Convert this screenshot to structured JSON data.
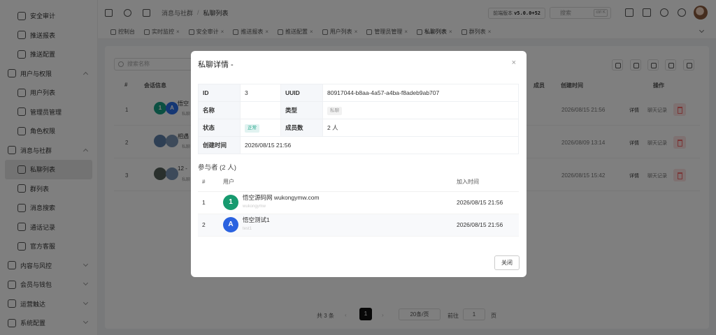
{
  "sidebar": {
    "items": [
      {
        "label": "安全审计",
        "level": 2
      },
      {
        "label": "推送报表",
        "level": 2
      },
      {
        "label": "推送配置",
        "level": 2
      },
      {
        "label": "用户与权限",
        "level": 1,
        "expanded": true
      },
      {
        "label": "用户列表",
        "level": 2
      },
      {
        "label": "管理员管理",
        "level": 2
      },
      {
        "label": "角色权限",
        "level": 2
      },
      {
        "label": "消息与社群",
        "level": 1,
        "expanded": true
      },
      {
        "label": "私聊列表",
        "level": 2,
        "active": true
      },
      {
        "label": "群列表",
        "level": 2
      },
      {
        "label": "消息搜索",
        "level": 2
      },
      {
        "label": "通话记录",
        "level": 2
      },
      {
        "label": "官方客服",
        "level": 2
      },
      {
        "label": "内容与风控",
        "level": 1,
        "expanded": false
      },
      {
        "label": "会员与钱包",
        "level": 1,
        "expanded": false
      },
      {
        "label": "运营触达",
        "level": 1,
        "expanded": false
      },
      {
        "label": "系统配置",
        "level": 1,
        "expanded": false
      }
    ]
  },
  "topbar": {
    "breadcrumb": [
      "消息与社群",
      "私聊列表"
    ],
    "breadcrumb_sep": "/",
    "version_label": "前端版本",
    "version": "v5.0.0+52",
    "search_placeholder": "搜索",
    "search_kbd": "ctrl K"
  },
  "tabs": [
    {
      "label": "控制台",
      "closable": false
    },
    {
      "label": "实时监控",
      "closable": true
    },
    {
      "label": "安全审计",
      "closable": true
    },
    {
      "label": "推送报表",
      "closable": true
    },
    {
      "label": "推送配置",
      "closable": true
    },
    {
      "label": "用户列表",
      "closable": true
    },
    {
      "label": "管理员管理",
      "closable": true
    },
    {
      "label": "私聊列表",
      "closable": true,
      "active": true
    },
    {
      "label": "群列表",
      "closable": true
    }
  ],
  "list": {
    "filter_placeholder": "搜索名称",
    "columns": {
      "index": "#",
      "info": "会话信息",
      "members": "成员",
      "created": "创建时间",
      "actions": "操作"
    },
    "rows": [
      {
        "index": "1",
        "name": "悟空",
        "type": "私聊",
        "avatars": [
          {
            "t": "1",
            "c": "#17a085"
          },
          {
            "t": "A",
            "c": "#2a6ee8"
          }
        ],
        "created": "2026/08/15 21:56",
        "detail": "详情",
        "records": "聊天记录"
      },
      {
        "index": "2",
        "name": "相遇",
        "type": "私聊",
        "avatars": [
          {
            "t": "",
            "c": "#5d7fa8"
          },
          {
            "t": "",
            "c": "#7a95b5"
          }
        ],
        "created": "2026/08/09 13:14",
        "detail": "详情",
        "records": "聊天记录"
      },
      {
        "index": "3",
        "name": "12 -",
        "type": "私聊",
        "avatars": [
          {
            "t": "",
            "c": "#55605a"
          },
          {
            "t": "",
            "c": "#7a95b5"
          }
        ],
        "created": "2026/08/15 15:42",
        "detail": "详情",
        "records": "聊天记录"
      }
    ],
    "pager": {
      "total": "共 3 条",
      "page": "1",
      "page_size": "20条/页",
      "goto_label": "前往",
      "goto_value": "1",
      "page_unit": "页"
    }
  },
  "modal": {
    "title": "私聊详情 -",
    "close_icon": "×",
    "details": {
      "id_label": "ID",
      "id": "3",
      "uuid_label": "UUID",
      "uuid": "80917044-b8aa-4a57-a4ba-f8adeb9ab707",
      "name_label": "名称",
      "name": "",
      "type_label": "类型",
      "type": "私聊",
      "status_label": "状态",
      "status": "正常",
      "members_label": "成员数",
      "members": "2 人",
      "created_label": "创建时间",
      "created": "2026/08/15 21:56"
    },
    "participants_title": "参与者 (2 人)",
    "participants_columns": {
      "index": "#",
      "user": "用户",
      "joined": "加入时间"
    },
    "participants": [
      {
        "index": "1",
        "avatar": "1",
        "color": "#179a6f",
        "name": "悟空源码网 wukongymw.com",
        "sub": "wukongymw",
        "joined": "2026/08/15 21:56"
      },
      {
        "index": "2",
        "avatar": "A",
        "color": "#2a62e0",
        "name": "悟空测试1",
        "sub": "test1",
        "joined": "2026/08/15 21:56"
      }
    ],
    "close_button": "关闭"
  }
}
